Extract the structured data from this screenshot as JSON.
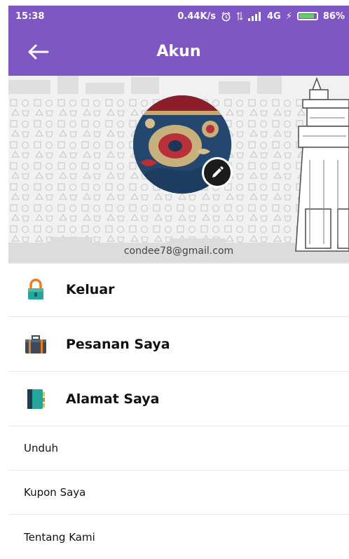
{
  "status": {
    "time": "15:38",
    "speed": "0.44K/s",
    "network": "4G",
    "battery": "86%",
    "battery_level": 0.86
  },
  "appbar": {
    "title": "Akun"
  },
  "profile": {
    "email": "condee78@gmail.com"
  },
  "menu": {
    "primary": [
      {
        "label": "Keluar",
        "icon": "lock-icon"
      },
      {
        "label": "Pesanan Saya",
        "icon": "briefcase-icon"
      },
      {
        "label": "Alamat Saya",
        "icon": "address-book-icon"
      }
    ],
    "secondary": [
      {
        "label": "Unduh"
      },
      {
        "label": "Kupon Saya"
      },
      {
        "label": "Tentang Kami"
      }
    ]
  },
  "colors": {
    "primary": "#7e57c2"
  }
}
